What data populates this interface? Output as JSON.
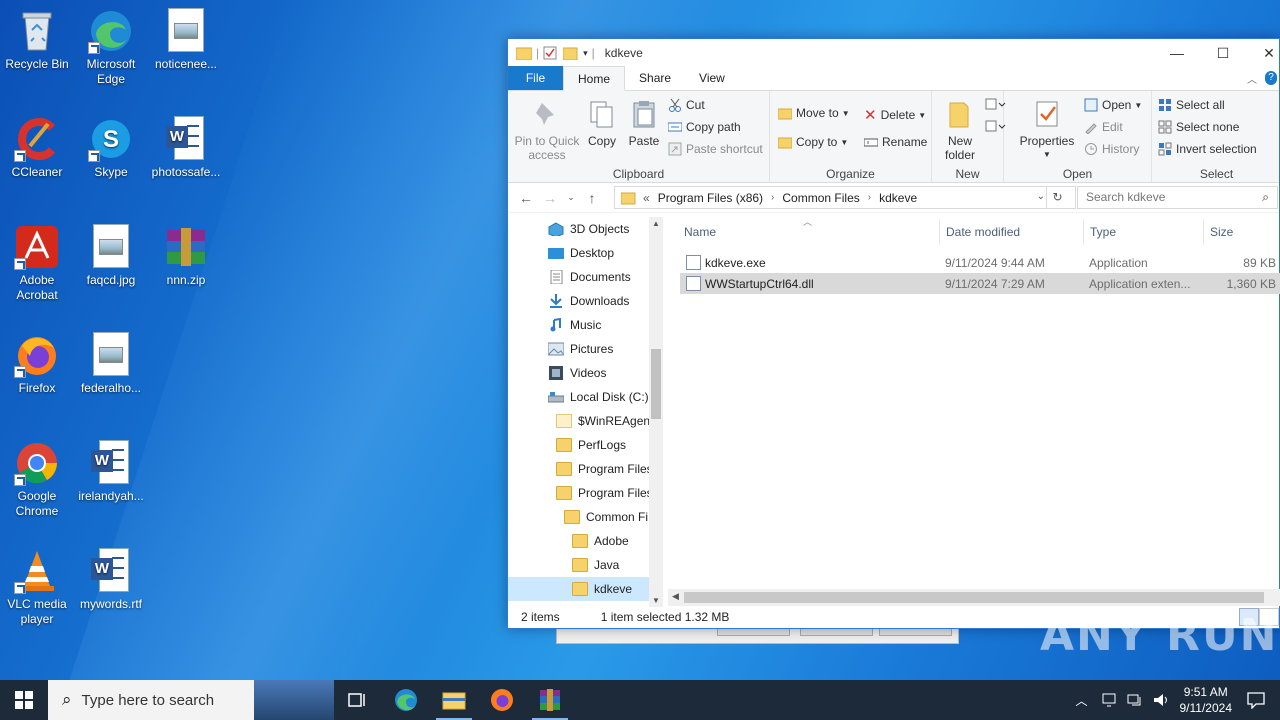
{
  "desktop": {
    "icons": [
      {
        "label": "Recycle Bin"
      },
      {
        "label": "Microsoft Edge"
      },
      {
        "label": "noticenee..."
      },
      {
        "label": "CCleaner"
      },
      {
        "label": "Skype"
      },
      {
        "label": "photossafe..."
      },
      {
        "label": "Adobe Acrobat"
      },
      {
        "label": "faqcd.jpg"
      },
      {
        "label": "nnn.zip"
      },
      {
        "label": "Firefox"
      },
      {
        "label": "federalho..."
      },
      {
        "label": "Google Chrome"
      },
      {
        "label": "irelandyah..."
      },
      {
        "label": "VLC media player"
      },
      {
        "label": "mywords.rtf"
      }
    ]
  },
  "explorer": {
    "title": "kdkeve",
    "controls": {
      "minimize": "—",
      "maximize": "☐",
      "close": "✕"
    },
    "menu": {
      "file": "File",
      "home": "Home",
      "share": "Share",
      "view": "View"
    },
    "ribbon": {
      "clipboard": {
        "label": "Clipboard",
        "pin": "Pin to Quick access",
        "copy": "Copy",
        "paste": "Paste",
        "cut": "Cut",
        "copy_path": "Copy path",
        "paste_shortcut": "Paste shortcut"
      },
      "organize": {
        "label": "Organize",
        "move_to": "Move to",
        "copy_to": "Copy to",
        "delete": "Delete",
        "rename": "Rename"
      },
      "new": {
        "label": "New",
        "new_folder": "New folder"
      },
      "open": {
        "label": "Open",
        "properties": "Properties",
        "open": "Open",
        "edit": "Edit",
        "history": "History"
      },
      "select": {
        "label": "Select",
        "select_all": "Select all",
        "select_none": "Select none",
        "invert": "Invert selection"
      }
    },
    "address": {
      "prefix": "«",
      "crumbs": [
        "Program Files (x86)",
        "Common Files",
        "kdkeve"
      ],
      "search_placeholder": "Search kdkeve"
    },
    "nav": [
      {
        "label": "3D Objects"
      },
      {
        "label": "Desktop"
      },
      {
        "label": "Documents"
      },
      {
        "label": "Downloads"
      },
      {
        "label": "Music"
      },
      {
        "label": "Pictures"
      },
      {
        "label": "Videos"
      },
      {
        "label": "Local Disk (C:)"
      },
      {
        "label": "$WinREAgent"
      },
      {
        "label": "PerfLogs"
      },
      {
        "label": "Program Files"
      },
      {
        "label": "Program Files"
      },
      {
        "label": "Common Fi"
      },
      {
        "label": "Adobe"
      },
      {
        "label": "Java"
      },
      {
        "label": "kdkeve"
      }
    ],
    "columns": {
      "name": "Name",
      "date": "Date modified",
      "type": "Type",
      "size": "Size"
    },
    "files": [
      {
        "name": "kdkeve.exe",
        "date": "9/11/2024 9:44 AM",
        "type": "Application",
        "size": "89 KB"
      },
      {
        "name": "WWStartupCtrl64.dll",
        "date": "9/11/2024 7:29 AM",
        "type": "Application exten...",
        "size": "1,360 KB"
      }
    ],
    "status": {
      "count": "2 items",
      "selection": "1 item selected  1.32 MB"
    }
  },
  "watermark": "ANY RUN",
  "taskbar": {
    "search_placeholder": "Type here to search",
    "time": "9:51 AM",
    "date": "9/11/2024"
  },
  "colors": {
    "accent": "#1979ca",
    "taskbar": "#1c2a3a",
    "selection": "#cce8ff"
  }
}
